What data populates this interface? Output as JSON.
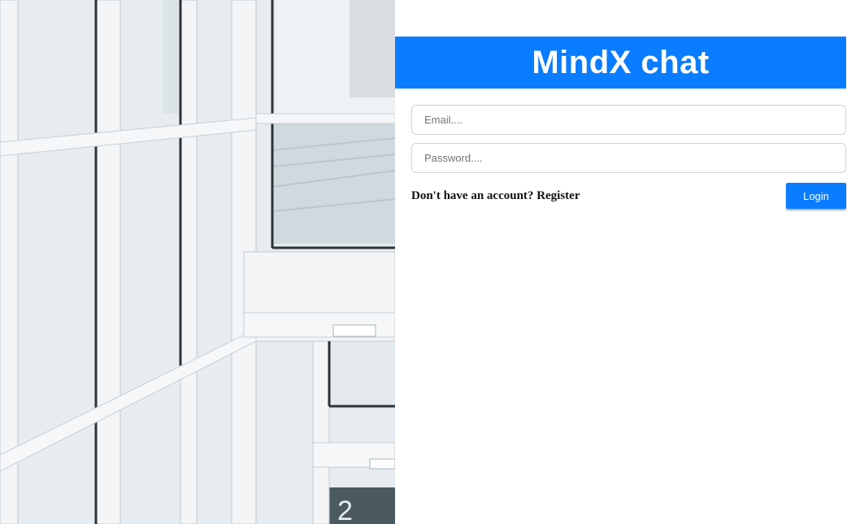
{
  "brand": {
    "title": "MindX chat",
    "color": "#0a7cff"
  },
  "form": {
    "email_placeholder": "Email....",
    "password_placeholder": "Password....",
    "register_prompt": "Don't have an account?",
    "register_link": "Register",
    "login_label": "Login"
  },
  "photo": {
    "floor_sign_number": "2"
  }
}
